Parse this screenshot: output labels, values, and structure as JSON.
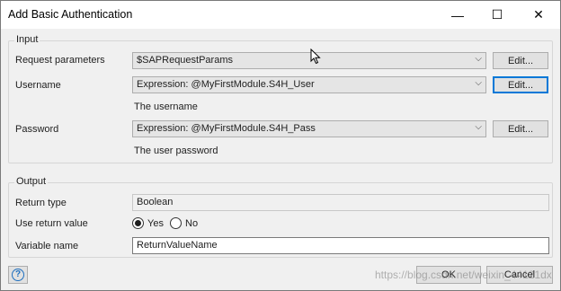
{
  "window": {
    "title": "Add Basic Authentication",
    "controls": {
      "minimize": "—",
      "maximize": "☐",
      "close": "✕"
    }
  },
  "input_group": {
    "label": "Input",
    "request_parameters": {
      "label": "Request parameters",
      "value": "$SAPRequestParams",
      "edit_label": "Edit..."
    },
    "username": {
      "label": "Username",
      "value": "Expression: @MyFirstModule.S4H_User",
      "edit_label": "Edit...",
      "hint": "The username"
    },
    "password": {
      "label": "Password",
      "value": "Expression: @MyFirstModule.S4H_Pass",
      "edit_label": "Edit...",
      "hint": "The user password"
    }
  },
  "output_group": {
    "label": "Output",
    "return_type": {
      "label": "Return type",
      "value": "Boolean"
    },
    "use_return_value": {
      "label": "Use return value",
      "options": [
        "Yes",
        "No"
      ],
      "selected": "Yes"
    },
    "variable_name": {
      "label": "Variable name",
      "value": "ReturnValueName"
    }
  },
  "footer": {
    "ok_label": "OK",
    "cancel_label": "Cancel",
    "watermark": "https://blog.csdn.net/weixin_44121dx"
  },
  "colors": {
    "focus_border": "#0078d7",
    "help_icon": "#1e6fbf",
    "window_bg": "#f0f0f0"
  }
}
